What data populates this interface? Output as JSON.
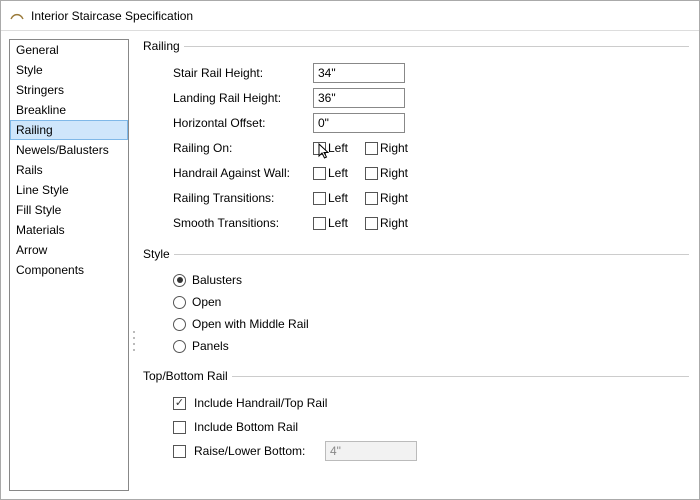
{
  "window": {
    "title": "Interior Staircase Specification"
  },
  "sidebar": {
    "items": [
      "General",
      "Style",
      "Stringers",
      "Breakline",
      "Railing",
      "Newels/Balusters",
      "Rails",
      "Line Style",
      "Fill Style",
      "Materials",
      "Arrow",
      "Components"
    ],
    "selected": 4
  },
  "railing": {
    "legend": "Railing",
    "stair_rail_height": {
      "label": "Stair Rail Height:",
      "value": "34\""
    },
    "landing_rail_height": {
      "label": "Landing Rail Height:",
      "value": "36\""
    },
    "horizontal_offset": {
      "label": "Horizontal Offset:",
      "value": "0\""
    },
    "railing_on": {
      "label": "Railing On:",
      "left": false,
      "right": false
    },
    "handrail_wall": {
      "label": "Handrail Against Wall:",
      "left": false,
      "right": false
    },
    "railing_trans": {
      "label": "Railing Transitions:",
      "left": false,
      "right": false
    },
    "smooth_trans": {
      "label": "Smooth Transitions:",
      "left": false,
      "right": false
    },
    "left_label": "Left",
    "right_label": "Right"
  },
  "style": {
    "legend": "Style",
    "options": [
      "Balusters",
      "Open",
      "Open with Middle Rail",
      "Panels"
    ],
    "selected": 0
  },
  "topbottom": {
    "legend": "Top/Bottom Rail",
    "include_top": {
      "label": "Include Handrail/Top Rail",
      "checked": true
    },
    "include_bottom": {
      "label": "Include Bottom Rail",
      "checked": false
    },
    "raise_lower": {
      "label": "Raise/Lower Bottom:",
      "value": "4\"",
      "enabled": false
    }
  }
}
